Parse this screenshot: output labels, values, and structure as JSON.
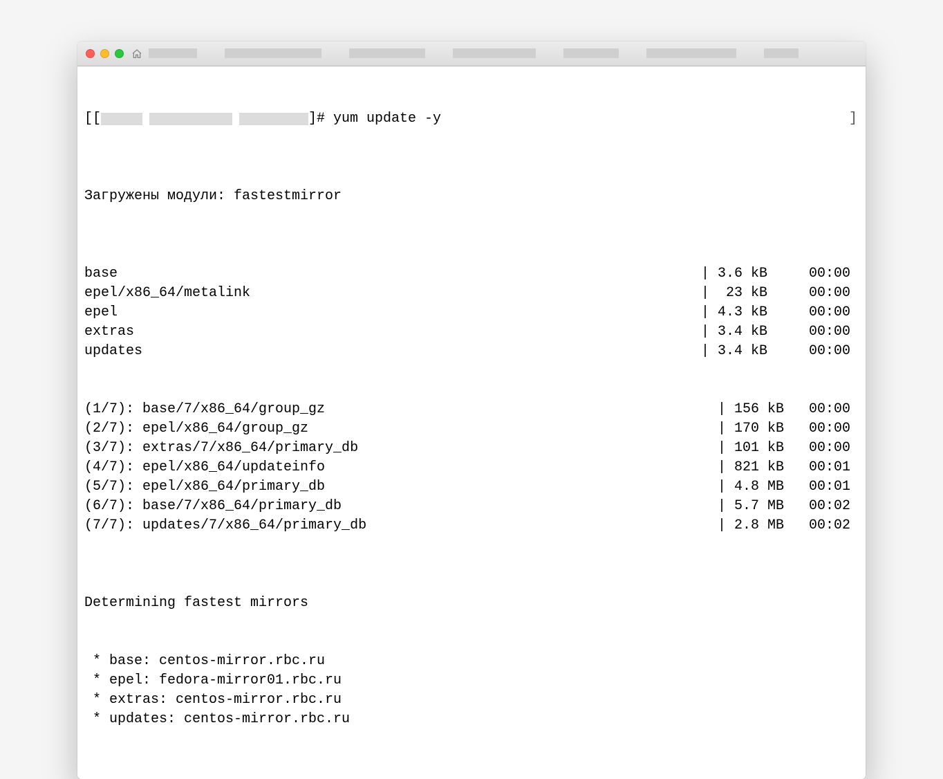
{
  "prompt": {
    "open": "[[",
    "close": "]#",
    "command": " yum update -y",
    "end_bracket": "]"
  },
  "modules_line": "Загружены модули: fastestmirror",
  "repo_rows": [
    {
      "name": "base",
      "size": "3.6 kB",
      "time": "00:00"
    },
    {
      "name": "epel/x86_64/metalink",
      "size": " 23 kB",
      "time": "00:00"
    },
    {
      "name": "epel",
      "size": "4.3 kB",
      "time": "00:00"
    },
    {
      "name": "extras",
      "size": "3.4 kB",
      "time": "00:00"
    },
    {
      "name": "updates",
      "size": "3.4 kB",
      "time": "00:00"
    }
  ],
  "download_rows": [
    {
      "idx": "(1/7)",
      "name": "base/7/x86_64/group_gz",
      "size": "156 kB",
      "time": "00:00"
    },
    {
      "idx": "(2/7)",
      "name": "epel/x86_64/group_gz",
      "size": "170 kB",
      "time": "00:00"
    },
    {
      "idx": "(3/7)",
      "name": "extras/7/x86_64/primary_db",
      "size": "101 kB",
      "time": "00:00"
    },
    {
      "idx": "(4/7)",
      "name": "epel/x86_64/updateinfo",
      "size": "821 kB",
      "time": "00:01"
    },
    {
      "idx": "(5/7)",
      "name": "epel/x86_64/primary_db",
      "size": "4.8 MB",
      "time": "00:01"
    },
    {
      "idx": "(6/7)",
      "name": "base/7/x86_64/primary_db",
      "size": "5.7 MB",
      "time": "00:02"
    },
    {
      "idx": "(7/7)",
      "name": "updates/7/x86_64/primary_db",
      "size": "2.8 MB",
      "time": "00:02"
    }
  ],
  "determining": "Determining fastest mirrors",
  "mirrors": [
    " * base: centos-mirror.rbc.ru",
    " * epel: fedora-mirror01.rbc.ru",
    " * extras: centos-mirror.rbc.ru",
    " * updates: centos-mirror.rbc.ru"
  ]
}
